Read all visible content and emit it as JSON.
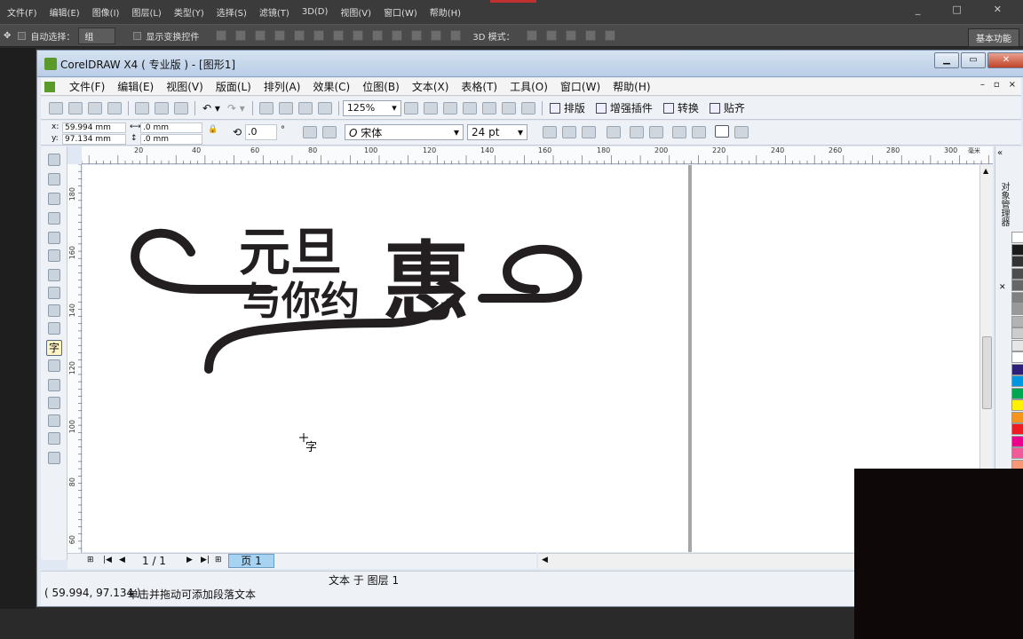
{
  "ps": {
    "menu": [
      "文件(F)",
      "编辑(E)",
      "图像(I)",
      "图层(L)",
      "类型(Y)",
      "选择(S)",
      "滤镜(T)",
      "3D(D)",
      "视图(V)",
      "窗口(W)",
      "帮助(H)"
    ],
    "options": {
      "auto_select_label": "自动选择：",
      "auto_select_value": "组",
      "show_transform_label": "显示变换控件",
      "mode_3d_label": "3D 模式：",
      "workspace_label": "基本功能"
    },
    "win_buttons": [
      "_",
      "□",
      "✕"
    ]
  },
  "cd": {
    "title": "CorelDRAW X4 ( 专业版 ) - [图形1]",
    "menu": [
      "文件(F)",
      "编辑(E)",
      "视图(V)",
      "版面(L)",
      "排列(A)",
      "效果(C)",
      "位图(B)",
      "文本(X)",
      "表格(T)",
      "工具(O)",
      "窗口(W)",
      "帮助(H)"
    ],
    "mdi_buttons": [
      "–",
      "▫",
      "×"
    ],
    "std_toolbar": {
      "zoom": "125%",
      "plugins": [
        "排版",
        "增强插件",
        "转换",
        "贴齐"
      ]
    },
    "property_bar": {
      "x_label": "x:",
      "x_value": "59.994 mm",
      "y_label": "y:",
      "y_value": "97.134 mm",
      "w_value": ".0 mm",
      "h_value": ".0 mm",
      "angle_value": ".0",
      "angle_unit": "°",
      "font_name": "宋体",
      "font_style_glyph": "O",
      "font_size": "24 pt"
    },
    "ruler": {
      "h_ticks": [
        "20",
        "40",
        "60",
        "80",
        "100",
        "120",
        "140",
        "160",
        "180",
        "200",
        "220",
        "240",
        "260",
        "280",
        "300"
      ],
      "h_unit": "毫米",
      "v_ticks": [
        "180",
        "160",
        "140",
        "120",
        "100",
        "80",
        "60"
      ]
    },
    "artwork": {
      "line1": "元旦",
      "big_char": "惠",
      "line2": "与你约"
    },
    "cursor_text_glyph": "字",
    "docker_label": "对象管理器",
    "page_nav": {
      "counter": "1 / 1",
      "tab": "页 1"
    },
    "status": {
      "coords": "( 59.994, 97.134 )",
      "hint": "单击并拖动可添加段落文本",
      "object_info": "文本 于 图层 1"
    },
    "palette_colors": [
      "#ffffff",
      "#1a1a1a",
      "#333333",
      "#4d4d4d",
      "#666666",
      "#808080",
      "#999999",
      "#b3b3b3",
      "#cccccc",
      "#e6e6e6",
      "#ffffff",
      "#2e1f78",
      "#0097e0",
      "#00a650",
      "#fff200",
      "#f7941d",
      "#ed1c24",
      "#ec008c",
      "#f15a99",
      "#f7977a",
      "#fbaf5d",
      "#fdc689",
      "#a3a1d0",
      "#c6b3dd"
    ]
  }
}
